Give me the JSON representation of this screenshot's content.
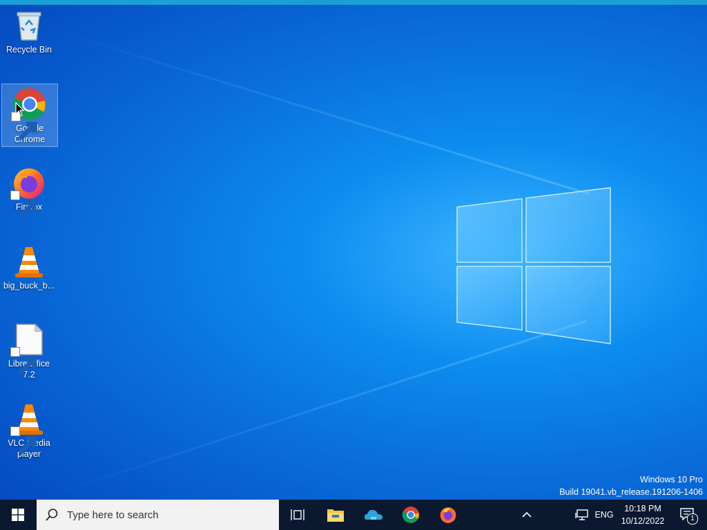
{
  "desktop": {
    "icons": [
      {
        "name": "recycle-bin",
        "label": "Recycle Bin",
        "icon": "recycle-bin-icon"
      },
      {
        "name": "google-chrome",
        "label": "Google Chrome",
        "icon": "chrome-icon",
        "selected": true
      },
      {
        "name": "firefox",
        "label": "Firefox",
        "icon": "firefox-icon"
      },
      {
        "name": "big-buck-bunny",
        "label": "big_buck_b...",
        "icon": "vlc-icon"
      },
      {
        "name": "libreoffice",
        "label": "LibreOffice 7.2",
        "icon": "libreoffice-icon"
      },
      {
        "name": "vlc-media-player",
        "label": "VLC media player",
        "icon": "vlc-icon"
      }
    ],
    "watermark": {
      "line1": "Windows 10 Pro",
      "line2": "Build 19041.vb_release.191206-1406"
    }
  },
  "taskbar": {
    "search_placeholder": "Type here to search",
    "pinned": [
      "task-view-icon",
      "file-explorer-icon",
      "onedrive-icon",
      "chrome-icon",
      "firefox-icon"
    ],
    "tray": {
      "language": "ENG",
      "time": "10:18 PM",
      "date": "10/12/2022",
      "notification_count": "1"
    }
  },
  "colors": {
    "taskbar": "#0b1930",
    "accent": "#0a6fdc"
  }
}
